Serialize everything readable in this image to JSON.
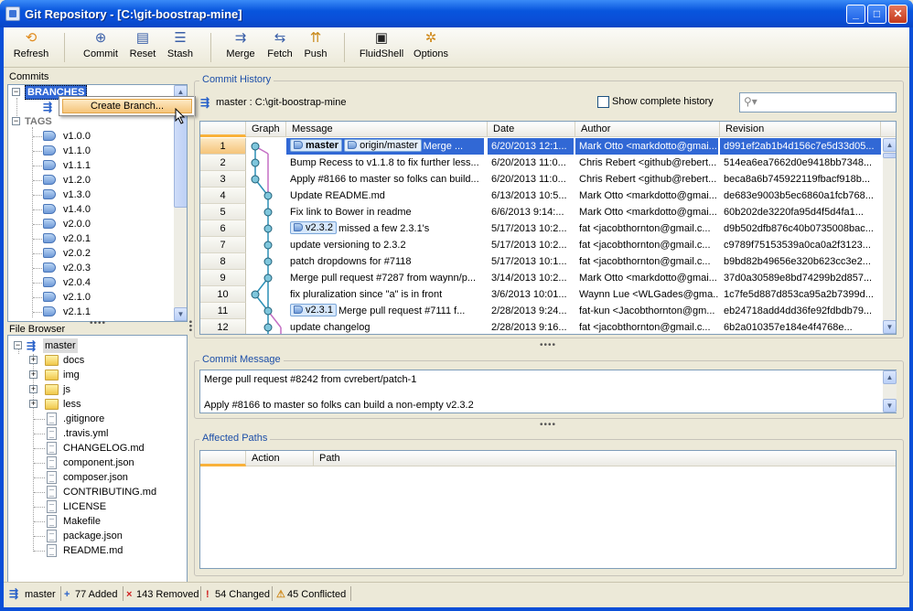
{
  "window": {
    "title": "Git Repository - [C:\\git-boostrap-mine]"
  },
  "toolbar": {
    "refresh": "Refresh",
    "commit": "Commit",
    "reset": "Reset",
    "stash": "Stash",
    "merge": "Merge",
    "fetch": "Fetch",
    "push": "Push",
    "fluidshell": "FluidShell",
    "options": "Options"
  },
  "commits_panel": {
    "label": "Commits",
    "branches_label": "BRANCHES",
    "tags_label": "TAGS",
    "tags": [
      "v1.0.0",
      "v1.1.0",
      "v1.1.1",
      "v1.2.0",
      "v1.3.0",
      "v1.4.0",
      "v2.0.0",
      "v2.0.1",
      "v2.0.2",
      "v2.0.3",
      "v2.0.4",
      "v2.1.0",
      "v2.1.1"
    ],
    "context_menu_item": "Create Branch..."
  },
  "file_browser": {
    "label": "File Browser",
    "root": "master",
    "folders": [
      "docs",
      "img",
      "js",
      "less"
    ],
    "files": [
      ".gitignore",
      ".travis.yml",
      "CHANGELOG.md",
      "component.json",
      "composer.json",
      "CONTRIBUTING.md",
      "LICENSE",
      "Makefile",
      "package.json",
      "README.md"
    ]
  },
  "commit_history": {
    "title": "Commit History",
    "branch_path": "master : C:\\git-boostrap-mine",
    "show_complete_history": "Show complete history",
    "search_placeholder": "",
    "columns": {
      "graph": "Graph",
      "message": "Message",
      "date": "Date",
      "author": "Author",
      "revision": "Revision"
    },
    "rows": [
      {
        "num": "1",
        "badges": [
          "master",
          "origin/master"
        ],
        "message": "Merge ...",
        "date": "6/20/2013 12:1...",
        "author": "Mark Otto <markdotto@gmai...",
        "revision": "d991ef2ab1b4d156c7e5d33d05..."
      },
      {
        "num": "2",
        "badges": [],
        "message": "Bump Recess to v1.1.8 to fix further less...",
        "date": "6/20/2013 11:0...",
        "author": "Chris Rebert <github@rebert...",
        "revision": "514ea6ea7662d0e9418bb7348..."
      },
      {
        "num": "3",
        "badges": [],
        "message": "Apply #8166 to master so folks can build...",
        "date": "6/20/2013 11:0...",
        "author": "Chris Rebert <github@rebert...",
        "revision": "beca8a6b745922119fbacf918b..."
      },
      {
        "num": "4",
        "badges": [],
        "message": "Update README.md",
        "date": "6/13/2013 10:5...",
        "author": "Mark Otto <markdotto@gmai...",
        "revision": "de683e9003b5ec6860a1fcb768..."
      },
      {
        "num": "5",
        "badges": [],
        "message": "Fix link to Bower in readme",
        "date": "6/6/2013 9:14:...",
        "author": "Mark Otto <markdotto@gmai...",
        "revision": "60b202de3220fa95d4f5d4fa1..."
      },
      {
        "num": "6",
        "badges": [
          "v2.3.2"
        ],
        "message": "missed a few 2.3.1's",
        "date": "5/17/2013 10:2...",
        "author": "fat <jacobthornton@gmail.c...",
        "revision": "d9b502dfb876c40b0735008bac..."
      },
      {
        "num": "7",
        "badges": [],
        "message": "update versioning to 2.3.2",
        "date": "5/17/2013 10:2...",
        "author": "fat <jacobthornton@gmail.c...",
        "revision": "c9789f75153539a0ca0a2f3123..."
      },
      {
        "num": "8",
        "badges": [],
        "message": "patch dropdowns for #7118",
        "date": "5/17/2013 10:1...",
        "author": "fat <jacobthornton@gmail.c...",
        "revision": "b9bd82b49656e320b623cc3e2..."
      },
      {
        "num": "9",
        "badges": [],
        "message": "Merge pull request #7287 from waynn/p...",
        "date": "3/14/2013 10:2...",
        "author": "Mark Otto <markdotto@gmai...",
        "revision": "37d0a30589e8bd74299b2d857..."
      },
      {
        "num": "10",
        "badges": [],
        "message": "fix pluralization since \"a\" is in front",
        "date": "3/6/2013 10:01...",
        "author": "Waynn Lue <WLGades@gma...",
        "revision": "1c7fe5d887d853ca95a2b7399d..."
      },
      {
        "num": "11",
        "badges": [
          "v2.3.1"
        ],
        "message": "Merge pull request #7111 f...",
        "date": "2/28/2013 9:24...",
        "author": "fat-kun <Jacobthornton@gm...",
        "revision": "eb24718add4dd36fe92fdbdb79..."
      },
      {
        "num": "12",
        "badges": [],
        "message": "update changelog",
        "date": "2/28/2013 9:16...",
        "author": "fat <jacobthornton@gmail.c...",
        "revision": "6b2a010357e184e4f4768e..."
      }
    ]
  },
  "commit_message": {
    "title": "Commit Message",
    "line1": "Merge pull request #8242 from cvrebert/patch-1",
    "line2": "Apply #8166 to master so folks can build a non-empty v2.3.2"
  },
  "affected_paths": {
    "title": "Affected Paths",
    "columns": {
      "action": "Action",
      "path": "Path"
    }
  },
  "status": {
    "branch": "master",
    "added": "77 Added",
    "removed": "143 Removed",
    "changed": "54 Changed",
    "conflicted": "45 Conflicted"
  },
  "colors": {
    "selection": "#3168d5",
    "title_bar": "#0a4fd8",
    "group_title": "#1c4ea8",
    "graph_node": "#2b8fb5",
    "graph_line": "#c46fc4"
  }
}
